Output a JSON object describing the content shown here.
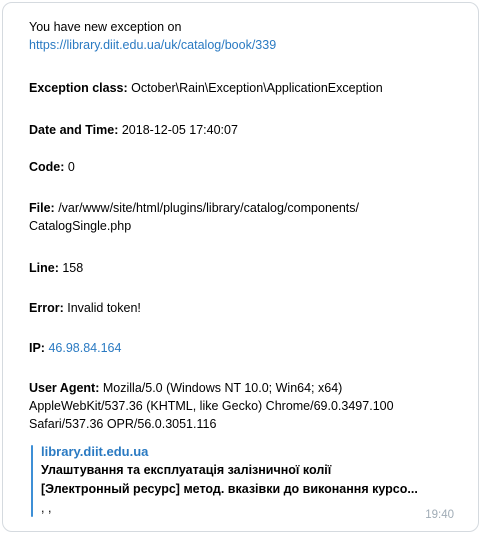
{
  "message": {
    "intro": "You have new exception on",
    "url": "https://library.diit.edu.ua/uk/catalog/book/339",
    "exception_label": "Exception class:",
    "exception_value": "October\\Rain\\Exception\\ApplicationException",
    "datetime_label": "Date and Time:",
    "datetime_value": "2018-12-05 17:40:07",
    "code_label": "Code:",
    "code_value": "0",
    "file_label": "File:",
    "file_value_line1": "/var/www/site/html/plugins/library/catalog/components/",
    "file_value_line2": "CatalogSingle.php",
    "line_label": "Line:",
    "line_value": "158",
    "error_label": "Error:",
    "error_value": "Invalid token!",
    "ip_label": "IP:",
    "ip_value": "46.98.84.164",
    "ua_label": "User Agent:",
    "ua_line1": "Mozilla/5.0 (Windows NT 10.0; Win64; x64)",
    "ua_line2": "AppleWebKit/537.36 (KHTML, like Gecko) Chrome/69.0.3497.100",
    "ua_line3": "Safari/537.36 OPR/56.0.3051.116"
  },
  "preview": {
    "site": "library.diit.edu.ua",
    "title_line1": "Улаштування та експлуатація залізничної колії",
    "title_line2": "[Электронный ресурс] метод. вказівки до виконання курсо...",
    "desc": ", ,"
  },
  "time": "19:40",
  "colors": {
    "link": "#2a7ac2",
    "timestamp": "#a0acb6",
    "border": "#d5dadf"
  }
}
